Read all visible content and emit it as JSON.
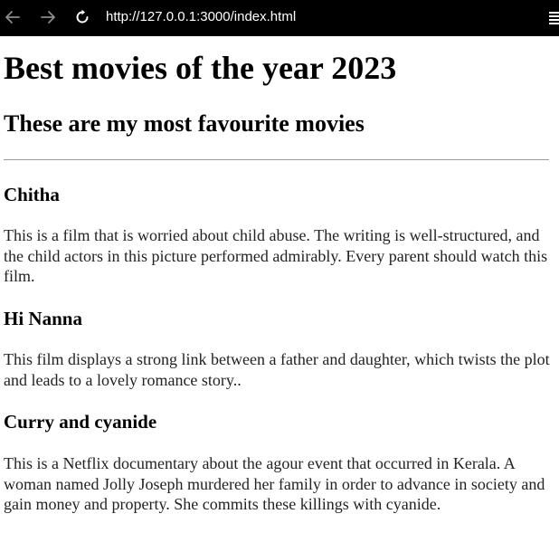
{
  "browser": {
    "url": "http://127.0.0.1:3000/index.html",
    "icons": {
      "back": "arrow-left-icon",
      "forward": "arrow-right-icon",
      "reload": "reload-icon",
      "menu": "menu-icon"
    }
  },
  "page": {
    "title": "Best movies of the year 2023",
    "subtitle": "These are my most favourite movies",
    "movies": [
      {
        "name": "Chitha",
        "description": "This is a film that is worried about child abuse. The writing is well-structured, and the child actors in this picture performed admirably. Every parent should watch this film."
      },
      {
        "name": "Hi Nanna",
        "description": "This film displays a strong link between a father and daughter, which twists the plot and leads to a lovely romance story.."
      },
      {
        "name": "Curry and cyanide",
        "description": "This is a Netflix documentary about the agour event that occurred in Kerala. A woman named Jolly Joseph murdered her family in order to advance in society and gain money and property. She commits these killings with cyanide."
      }
    ]
  }
}
